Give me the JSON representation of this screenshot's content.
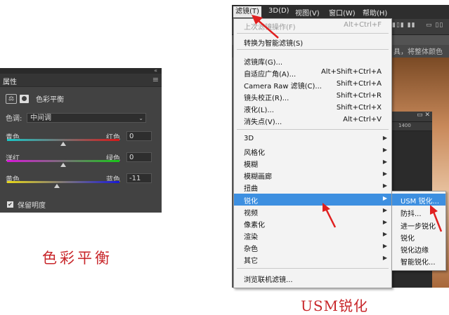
{
  "panel": {
    "tab": "属性",
    "title": "色彩平衡",
    "tone_label": "色调:",
    "tone_value": "中间调",
    "sliders": [
      {
        "left": "青色",
        "right": "红色",
        "value": "0",
        "level": 0,
        "gradient": "linear-gradient(90deg,#18c8c8,#d81818)"
      },
      {
        "left": "洋红",
        "right": "绿色",
        "value": "0",
        "level": 0,
        "gradient": "linear-gradient(90deg,#d818d8,#18c818)"
      },
      {
        "left": "黄色",
        "right": "蓝色",
        "value": "-11",
        "level": -11,
        "gradient": "linear-gradient(90deg,#e8d818,#1818d8)"
      }
    ],
    "preserve_label": "保留明度",
    "preserve_checked": true
  },
  "captions": {
    "left": "色彩平衡",
    "right": "USM锐化"
  },
  "menubar": {
    "items": [
      "滤镜(T)",
      "3D(D)",
      "视图(V)",
      "窗口(W)",
      "帮助(H)"
    ],
    "active_index": 0
  },
  "background": {
    "hint": "具，将整体颜色",
    "ruler_mark": "1400"
  },
  "menu": {
    "items": [
      {
        "label": "上次滤镜操作(F)",
        "shortcut": "Alt+Ctrl+F",
        "disabled": true
      },
      {
        "label": "转换为智能滤镜(S)",
        "shortcut": ""
      },
      {
        "label": "滤镜库(G)...",
        "shortcut": ""
      },
      {
        "label": "自适应广角(A)...",
        "shortcut": "Alt+Shift+Ctrl+A"
      },
      {
        "label": "Camera Raw 滤镜(C)...",
        "shortcut": "Shift+Ctrl+A"
      },
      {
        "label": "镜头校正(R)...",
        "shortcut": "Shift+Ctrl+R"
      },
      {
        "label": "液化(L)...",
        "shortcut": "Shift+Ctrl+X"
      },
      {
        "label": "消失点(V)...",
        "shortcut": "Alt+Ctrl+V"
      },
      {
        "label": "3D",
        "submenu": true
      },
      {
        "label": "风格化",
        "submenu": true
      },
      {
        "label": "模糊",
        "submenu": true
      },
      {
        "label": "模糊画廊",
        "submenu": true
      },
      {
        "label": "扭曲",
        "submenu": true
      },
      {
        "label": "锐化",
        "submenu": true,
        "hover": true
      },
      {
        "label": "视频",
        "submenu": true
      },
      {
        "label": "像素化",
        "submenu": true
      },
      {
        "label": "渲染",
        "submenu": true
      },
      {
        "label": "杂色",
        "submenu": true
      },
      {
        "label": "其它",
        "submenu": true
      },
      {
        "label": "浏览联机滤镜...",
        "shortcut": ""
      }
    ]
  },
  "submenu": {
    "items": [
      "USM 锐化...",
      "防抖...",
      "进一步锐化",
      "锐化",
      "锐化边缘",
      "智能锐化..."
    ],
    "hover_index": 0
  },
  "colors": {
    "highlight": "#3d8fe0",
    "annotation": "#e02020",
    "caption": "#c8262a"
  }
}
